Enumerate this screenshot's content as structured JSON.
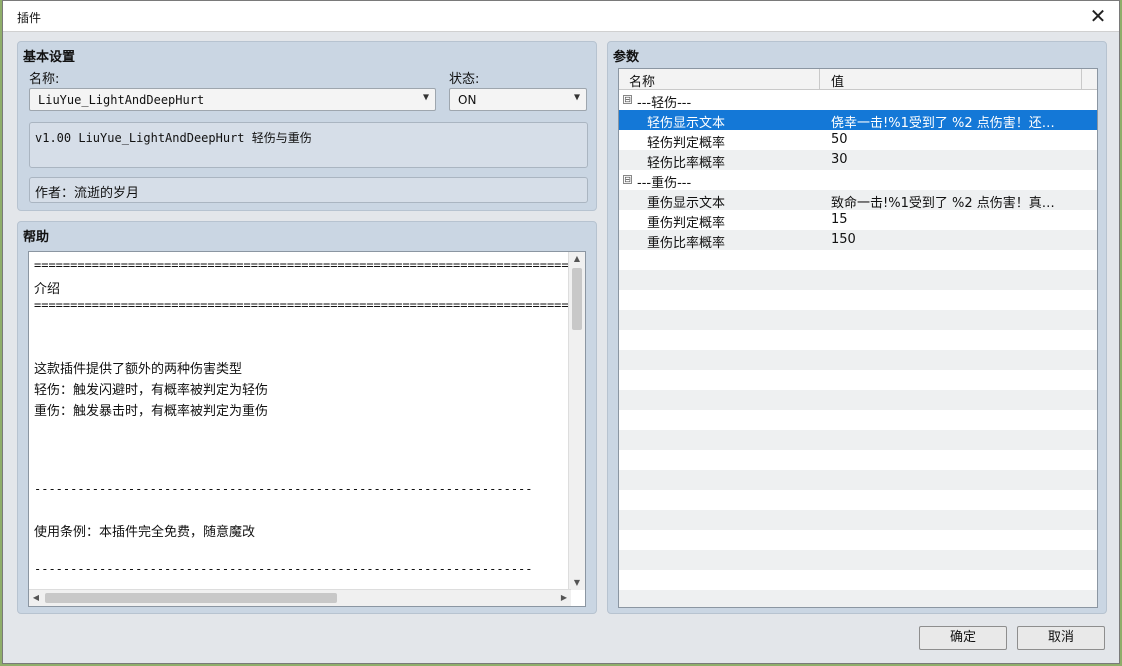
{
  "window": {
    "title": "插件",
    "close_glyph": "✕"
  },
  "basic": {
    "heading": "基本设置",
    "name_label": "名称:",
    "name_value": "LiuYue_LightAndDeepHurt",
    "status_label": "状态:",
    "status_value": "ON",
    "description": "v1.00 LiuYue_LightAndDeepHurt 轻伤与重伤",
    "author": "作者：流逝的岁月"
  },
  "help": {
    "heading": "帮助",
    "lines": [
      "===========================================================================",
      "介绍",
      "=========================================================================== *",
      "这款插件提供了额外的两种伤害类型",
      "轻伤：触发闪避时，有概率被判定为轻伤",
      "重伤：触发暴击时，有概率被判定为重伤",
      "---------------------------------------------------------------------",
      "使用条例：本插件完全免费，随意魔改",
      "---------------------------------------------------------------------"
    ]
  },
  "params": {
    "heading": "参数",
    "col_name": "名称",
    "col_value": "值",
    "groups": [
      {
        "label": "---轻伤---",
        "toggle": "⊟",
        "rows": [
          {
            "name": "轻伤显示文本",
            "value": "侥幸一击!%1受到了 %2 点伤害！还…"
          },
          {
            "name": "轻伤判定概率",
            "value": "50"
          },
          {
            "name": "轻伤比率概率",
            "value": "30"
          }
        ]
      },
      {
        "label": "---重伤---",
        "toggle": "⊟",
        "rows": [
          {
            "name": "重伤显示文本",
            "value": "致命一击!%1受到了 %2 点伤害！真…"
          },
          {
            "name": "重伤判定概率",
            "value": "15"
          },
          {
            "name": "重伤比率概率",
            "value": "150"
          }
        ]
      }
    ]
  },
  "buttons": {
    "ok": "确定",
    "cancel": "取消"
  }
}
